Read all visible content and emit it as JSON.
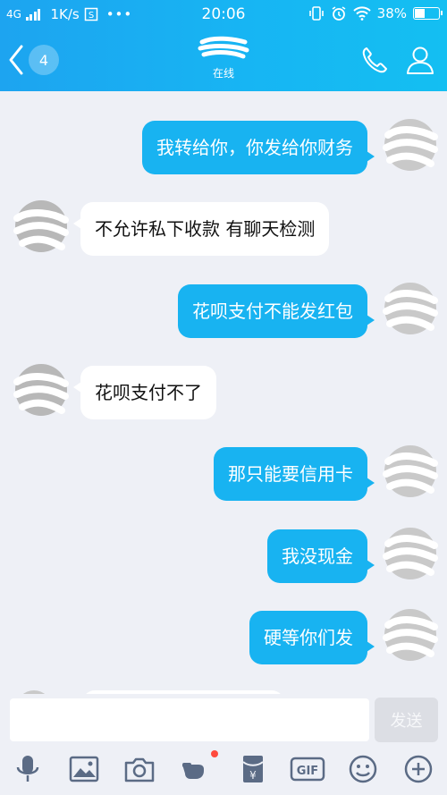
{
  "status_bar": {
    "network_type": "4G",
    "speed": "1K/s",
    "time": "20:06",
    "battery": "38%",
    "battery_level": 0.38
  },
  "header": {
    "unread_count": "4",
    "contact_status": "在线"
  },
  "messages": [
    {
      "direction": "out",
      "text": "我转给你，你发给你财务"
    },
    {
      "direction": "in",
      "text": "不允许私下收款 有聊天检测"
    },
    {
      "direction": "out",
      "text": "花呗支付不能发红包"
    },
    {
      "direction": "in",
      "text": "花呗支付不了"
    },
    {
      "direction": "out",
      "text": "那只能要信用卡"
    },
    {
      "direction": "out",
      "text": "我没现金"
    },
    {
      "direction": "out",
      "text": "硬等你们发"
    }
  ],
  "input": {
    "value": "",
    "send_label": "发送"
  },
  "toolbar": {
    "icons": [
      "microphone-icon",
      "image-icon",
      "camera-icon",
      "poke-icon",
      "red-packet-icon",
      "gif-icon",
      "emoji-icon",
      "plus-icon"
    ]
  },
  "colors": {
    "header_blue": "#17b5f3",
    "outgoing_bubble": "#18b3f1",
    "incoming_bubble": "#ffffff",
    "chat_background": "#eef0f6",
    "notification_dot": "#ff4a3d"
  }
}
